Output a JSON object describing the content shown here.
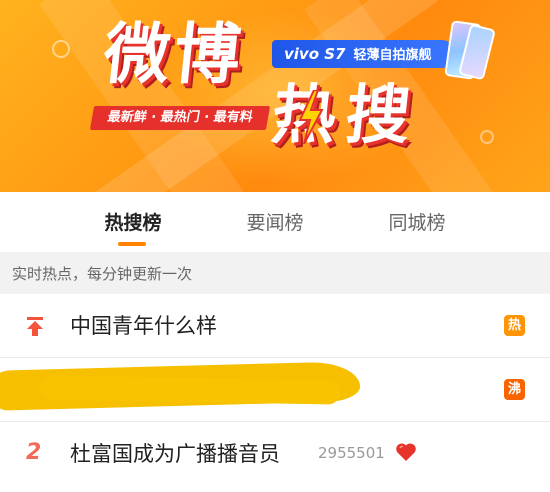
{
  "banner": {
    "title_main": "微博",
    "title_sub": "热搜",
    "slogan": "最新鲜 · 最热门 · 最有料",
    "ad_brand": "vivo S7",
    "ad_text": "轻薄自拍旗舰",
    "colors": {
      "banner_bg": "#ff9d14",
      "title_shadow": "#e8322c",
      "ad_bg": "#1f56e8"
    }
  },
  "tabs": [
    {
      "label": "热搜榜",
      "active": true
    },
    {
      "label": "要闻榜",
      "active": false
    },
    {
      "label": "同城榜",
      "active": false
    }
  ],
  "notice": "实时热点，每分钟更新一次",
  "list": [
    {
      "rank_icon": "pin-top-icon",
      "title": "中国青年什么样",
      "badge": "热",
      "badge_color": "#ff9406"
    },
    {
      "title_redacted": true,
      "badge": "沸",
      "badge_color": "#f86400"
    },
    {
      "rank": "2",
      "title": "杜富国成为广播播音员",
      "count": "2955501",
      "emoji": "heart-icon"
    }
  ]
}
